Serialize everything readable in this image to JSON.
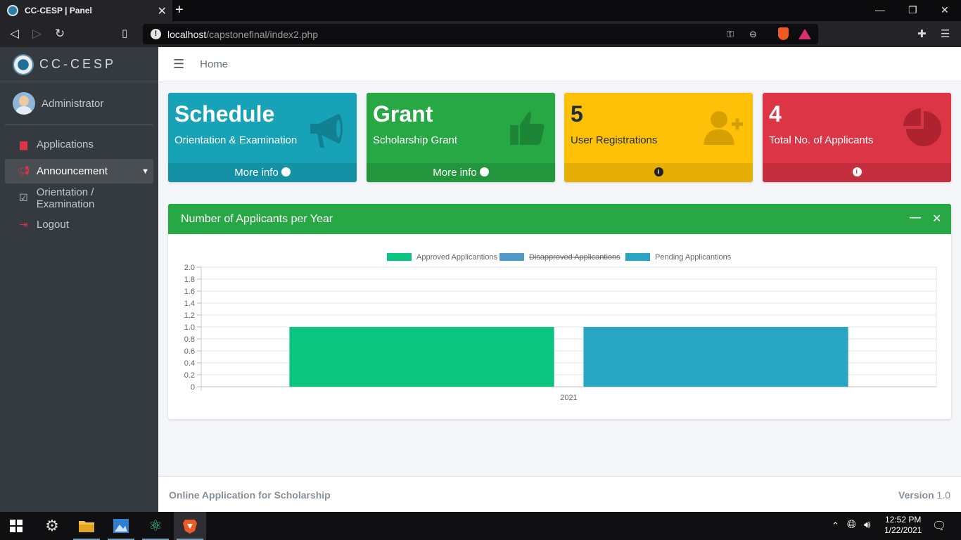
{
  "browser": {
    "tab_title": "CC-CESP | Panel",
    "url_host": "localhost",
    "url_path": "/capstonefinal/index2.php"
  },
  "sidebar": {
    "brand": "CC-CESP",
    "user": "Administrator",
    "items": [
      {
        "label": "Applications",
        "icon": "archive-icon"
      },
      {
        "label": "Announcement",
        "icon": "bullhorn-icon",
        "active": true
      },
      {
        "label": "Orientation / Examination",
        "icon": "calendar-check-icon"
      },
      {
        "label": "Logout",
        "icon": "sign-out-icon"
      }
    ]
  },
  "topnav": {
    "home": "Home"
  },
  "boxes": [
    {
      "big": "Schedule",
      "sub": "Orientation & Examination",
      "footer": "More info",
      "color": "#17a2b8",
      "icon": "bullhorn-icon"
    },
    {
      "big": "Grant",
      "sub": "Scholarship Grant",
      "footer": "More info",
      "color": "#28a745",
      "icon": "thumbs-up-icon"
    },
    {
      "big": "5",
      "sub": "User Registrations",
      "footer": "",
      "color": "#ffc107",
      "icon": "user-plus-icon"
    },
    {
      "big": "4",
      "sub": "Total No. of Applicants",
      "footer": "",
      "color": "#dc3545",
      "icon": "pie-chart-icon"
    }
  ],
  "card": {
    "title": "Number of Applicants per Year"
  },
  "chart_data": {
    "type": "bar",
    "categories": [
      "2021"
    ],
    "series": [
      {
        "name": "Approved Applicantions",
        "values": [
          1
        ],
        "color": "#0ac47f",
        "hidden": false
      },
      {
        "name": "Disapproved Applicantions",
        "values": [
          0
        ],
        "color": "#4f9ac8",
        "hidden": true
      },
      {
        "name": "Pending Applicantions",
        "values": [
          1
        ],
        "color": "#28a6c3",
        "hidden": false
      }
    ],
    "ylim": [
      0,
      2
    ],
    "yticks": [
      "2.0",
      "1.8",
      "1.6",
      "1.4",
      "1.2",
      "1.0",
      "0.8",
      "0.6",
      "0.4",
      "0.2",
      "0"
    ],
    "legend": "top",
    "grid": true
  },
  "footer": {
    "left": "Online Application for Scholarship",
    "version_label": "Version",
    "version": "1.0"
  },
  "taskbar": {
    "time": "12:52 PM",
    "date": "1/22/2021"
  }
}
